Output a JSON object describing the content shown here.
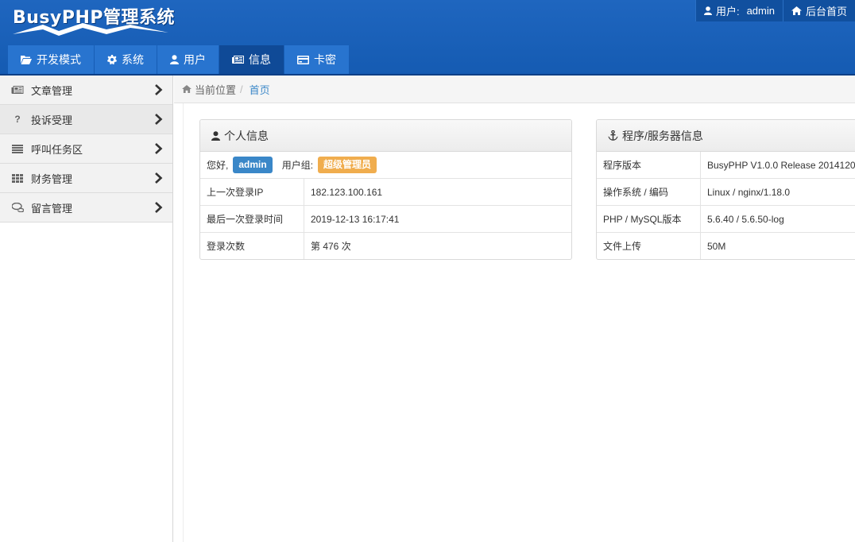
{
  "header": {
    "logo_text": "BusyPHP管理系统",
    "user_label": "用户:",
    "user_name": "admin",
    "home_link": "后台首页"
  },
  "nav": {
    "tabs": [
      {
        "label": "开发模式",
        "icon": "folder-open-icon"
      },
      {
        "label": "系统",
        "icon": "gear-icon"
      },
      {
        "label": "用户",
        "icon": "user-icon"
      },
      {
        "label": "信息",
        "icon": "newspaper-icon",
        "active": true
      },
      {
        "label": "卡密",
        "icon": "credit-card-icon"
      }
    ]
  },
  "sidebar": {
    "items": [
      {
        "label": "文章管理",
        "icon": "newspaper-icon"
      },
      {
        "label": "投诉受理",
        "icon": "question-icon"
      },
      {
        "label": "呼叫任务区",
        "icon": "list-icon"
      },
      {
        "label": "财务管理",
        "icon": "grid-icon"
      },
      {
        "label": "留言管理",
        "icon": "comments-icon"
      }
    ]
  },
  "breadcrumb": {
    "prefix": "当前位置",
    "separator": "/",
    "current": "首页"
  },
  "personal_panel": {
    "title": "个人信息",
    "greeting": "您好,",
    "user_badge": "admin",
    "group_label": "用户组:",
    "group_badge": "超级管理员",
    "rows": [
      {
        "label": "上一次登录IP",
        "value": "182.123.100.161"
      },
      {
        "label": "最后一次登录时间",
        "value": "2019-12-13 16:17:41"
      },
      {
        "label": "登录次数",
        "value": "第 476 次"
      }
    ]
  },
  "server_panel": {
    "title": "程序/服务器信息",
    "rows": [
      {
        "label": "程序版本",
        "value": "BusyPHP V1.0.0 Release 2014120"
      },
      {
        "label": "操作系统 / 编码",
        "value": "Linux / nginx/1.18.0"
      },
      {
        "label": "PHP / MySQL版本",
        "value": "5.6.40 / 5.6.50-log"
      },
      {
        "label": "文件上传",
        "value": "50M"
      }
    ]
  },
  "colors": {
    "header_bg": "#1a60b8",
    "nav_tab": "#2874cf",
    "nav_active": "#0f4a97",
    "badge_blue": "#3a87c8",
    "badge_orange": "#f0ad4e"
  }
}
